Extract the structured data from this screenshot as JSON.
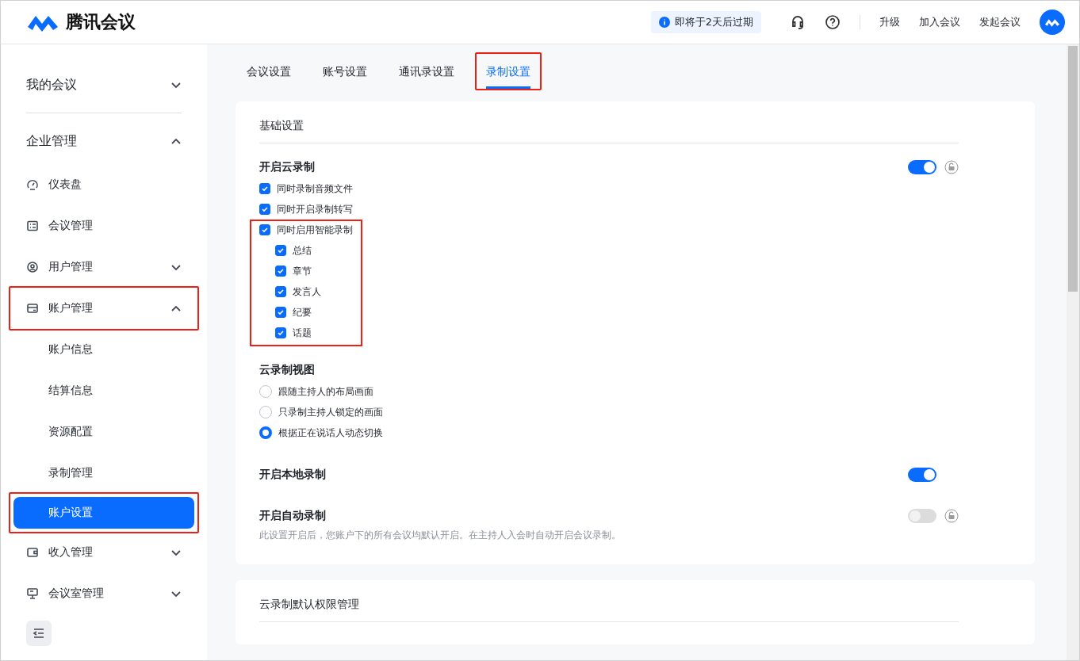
{
  "header": {
    "logo_text": "腾讯会议",
    "notice": "即将于2天后过期",
    "links": [
      "升级",
      "加入会议",
      "发起会议"
    ]
  },
  "sidebar": {
    "items": [
      {
        "label": "我的会议",
        "expanded": false,
        "highlighted": false
      },
      {
        "label": "企业管理",
        "expanded": true,
        "highlighted": false,
        "children": [
          {
            "label": "仪表盘",
            "highlighted": false
          },
          {
            "label": "会议管理",
            "highlighted": false
          },
          {
            "label": "用户管理",
            "expanded": false,
            "highlighted": false
          },
          {
            "label": "账户管理",
            "expanded": true,
            "highlighted": true,
            "children": [
              {
                "label": "账户信息",
                "selected": false,
                "highlighted": false
              },
              {
                "label": "结算信息",
                "selected": false,
                "highlighted": false
              },
              {
                "label": "资源配置",
                "selected": false,
                "highlighted": false
              },
              {
                "label": "录制管理",
                "selected": false,
                "highlighted": false
              },
              {
                "label": "账户设置",
                "selected": true,
                "highlighted": true
              }
            ]
          },
          {
            "label": "收入管理",
            "expanded": false,
            "highlighted": false
          },
          {
            "label": "会议室管理",
            "expanded": false,
            "highlighted": false
          }
        ]
      }
    ]
  },
  "tabs": [
    {
      "label": "会议设置",
      "selected": false,
      "highlighted": false
    },
    {
      "label": "账号设置",
      "selected": false,
      "highlighted": false
    },
    {
      "label": "通讯录设置",
      "selected": false,
      "highlighted": false
    },
    {
      "label": "录制设置",
      "selected": true,
      "highlighted": true
    }
  ],
  "cards": [
    {
      "title": "基础设置",
      "settings": [
        {
          "title": "开启云录制",
          "toggle": {
            "on": true,
            "lockable": true
          },
          "options": [
            {
              "label": "同时录制音频文件",
              "checked": true,
              "highlighted": false
            },
            {
              "label": "同时开启录制转写",
              "checked": true,
              "highlighted": false
            },
            {
              "label": "同时启用智能录制",
              "checked": true,
              "highlighted": true,
              "children": [
                {
                  "label": "总结",
                  "checked": true
                },
                {
                  "label": "章节",
                  "checked": true
                },
                {
                  "label": "发言人",
                  "checked": true
                },
                {
                  "label": "纪要",
                  "checked": true
                },
                {
                  "label": "话题",
                  "checked": true
                }
              ]
            }
          ]
        },
        {
          "title": "云录制视图",
          "radios": [
            {
              "label": "跟随主持人的布局画面",
              "selected": false
            },
            {
              "label": "只录制主持人锁定的画面",
              "selected": false
            },
            {
              "label": "根据正在说话人动态切换",
              "selected": true
            }
          ]
        },
        {
          "title": "开启本地录制",
          "toggle": {
            "on": true,
            "lockable": false
          }
        },
        {
          "title": "开启自动录制",
          "toggle": {
            "on": false,
            "lockable": true
          },
          "description": "此设置开启后，您账户下的所有会议均默认开启。在主持人入会时自动开启会议录制。"
        }
      ]
    },
    {
      "title": "云录制默认权限管理"
    }
  ]
}
